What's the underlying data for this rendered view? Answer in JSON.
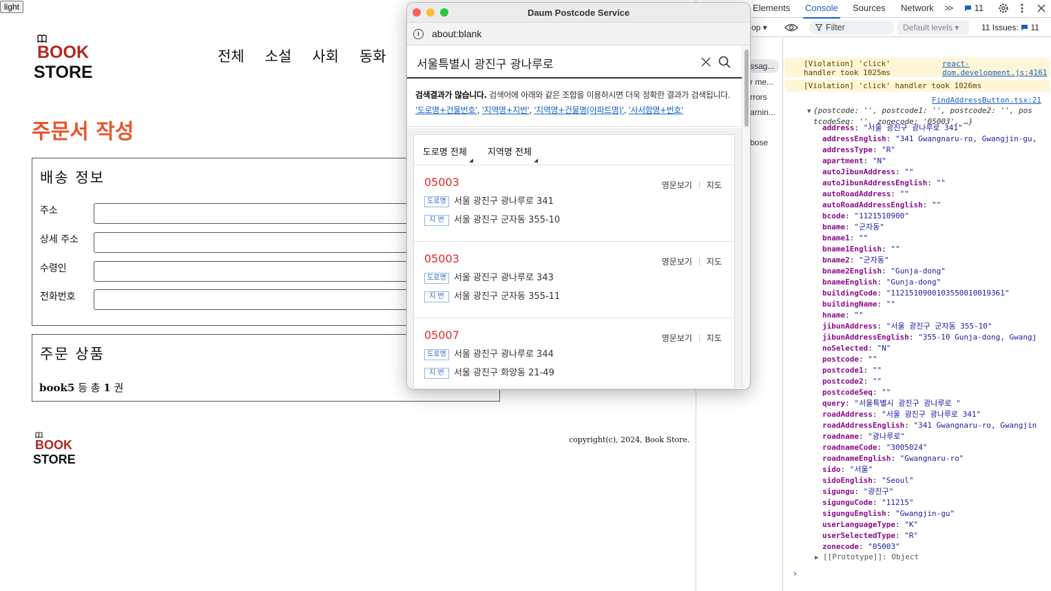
{
  "theme_toggle": "light",
  "logo": {
    "line1": "BOOK",
    "line2": "STORE"
  },
  "nav": [
    "전체",
    "소설",
    "사회",
    "동화"
  ],
  "page_title": "주문서 작성",
  "delivery": {
    "title": "배송 정보",
    "fields": [
      {
        "label": "주소",
        "value": ""
      },
      {
        "label": "상세 주소",
        "value": ""
      },
      {
        "label": "수령인",
        "value": ""
      },
      {
        "label": "전화번호",
        "value": ""
      }
    ]
  },
  "order": {
    "title": "주문 상품",
    "first_book": "book5",
    "mid": " 등 총 ",
    "count": "1",
    "unit": " 권"
  },
  "footer": {
    "logo_line1": "BOOK",
    "logo_line2": "STORE",
    "copyright": "copyright(c), 2024, Book Store."
  },
  "popup": {
    "window_title": "Daum Postcode Service",
    "url": "about:blank",
    "query": "서울특별시 광진구 광나루로",
    "notice_bold": "검색결과가 많습니다.",
    "notice_text": " 검색어에 아래와 같은 조합을 이용하시면 더욱 정확한 결과가 검색됩니다.",
    "hints": [
      "'도로명+건물번호'",
      "'지역명+지번'",
      "'지역명+건물명(아파트명)'",
      "'사서함명+번호'"
    ],
    "filters": [
      "도로명 전체",
      "지역명 전체"
    ],
    "links": {
      "english": "영문보기",
      "map": "지도"
    },
    "tags": {
      "road": "도로명",
      "jibun": "지 번"
    },
    "results": [
      {
        "zip": "05003",
        "road": "서울 광진구 광나루로 341",
        "jibun": "서울 광진구 군자동 355-10"
      },
      {
        "zip": "05003",
        "road": "서울 광진구 광나루로 343",
        "jibun": "서울 광진구 군자동 355-11"
      },
      {
        "zip": "05007",
        "road": "서울 광진구 광나루로 344",
        "jibun": "서울 광진구 화양동 21-49"
      }
    ]
  },
  "devtools": {
    "tabs": [
      "Elements",
      "Console",
      "Sources",
      "Network"
    ],
    "more": ">>",
    "msg_count": "11",
    "context": "op",
    "filter_placeholder": "Filter",
    "levels": "Default levels",
    "issues_label": "11 Issues:",
    "issues_count": "11",
    "sidebar": [
      "ssag...",
      "r me...",
      "rrors",
      "arnin...",
      "bose"
    ],
    "warnings": [
      {
        "text": "[Violation] 'click' handler took 1025ms",
        "link": "react-dom.development.js:4161"
      },
      {
        "text": "[Violation] 'click' handler took 1026ms",
        "link": ""
      }
    ],
    "source_link": "FindAddressButton.tsx:21",
    "object_summary_a": "{postcode: '', postcode1: '', postcode2: '', pos",
    "object_summary_b": "tcodeSeq: '', zonecode: '05003', …}",
    "properties": [
      {
        "k": "address",
        "v": "\"서울 광진구 광나루로 341\""
      },
      {
        "k": "addressEnglish",
        "v": "\"341 Gwangnaru-ro, Gwangjin-gu,"
      },
      {
        "k": "addressType",
        "v": "\"R\""
      },
      {
        "k": "apartment",
        "v": "\"N\""
      },
      {
        "k": "autoJibunAddress",
        "v": "\"\""
      },
      {
        "k": "autoJibunAddressEnglish",
        "v": "\"\""
      },
      {
        "k": "autoRoadAddress",
        "v": "\"\""
      },
      {
        "k": "autoRoadAddressEnglish",
        "v": "\"\""
      },
      {
        "k": "bcode",
        "v": "\"1121510900\""
      },
      {
        "k": "bname",
        "v": "\"군자동\""
      },
      {
        "k": "bname1",
        "v": "\"\""
      },
      {
        "k": "bname1English",
        "v": "\"\""
      },
      {
        "k": "bname2",
        "v": "\"군자동\""
      },
      {
        "k": "bname2English",
        "v": "\"Gunja-dong\""
      },
      {
        "k": "bnameEnglish",
        "v": "\"Gunja-dong\""
      },
      {
        "k": "buildingCode",
        "v": "\"1121510900103550010019361\""
      },
      {
        "k": "buildingName",
        "v": "\"\""
      },
      {
        "k": "hname",
        "v": "\"\""
      },
      {
        "k": "jibunAddress",
        "v": "\"서울 광진구 군자동 355-10\""
      },
      {
        "k": "jibunAddressEnglish",
        "v": "\"355-10 Gunja-dong, Gwangj"
      },
      {
        "k": "noSelected",
        "v": "\"N\""
      },
      {
        "k": "postcode",
        "v": "\"\""
      },
      {
        "k": "postcode1",
        "v": "\"\""
      },
      {
        "k": "postcode2",
        "v": "\"\""
      },
      {
        "k": "postcodeSeq",
        "v": "\"\""
      },
      {
        "k": "query",
        "v": "\"서울특별시 광진구 광나루로 \""
      },
      {
        "k": "roadAddress",
        "v": "\"서울 광진구 광나루로 341\""
      },
      {
        "k": "roadAddressEnglish",
        "v": "\"341 Gwangnaru-ro, Gwangjin"
      },
      {
        "k": "roadname",
        "v": "\"광나루로\""
      },
      {
        "k": "roadnameCode",
        "v": "\"3005024\""
      },
      {
        "k": "roadnameEnglish",
        "v": "\"Gwangnaru-ro\""
      },
      {
        "k": "sido",
        "v": "\"서울\""
      },
      {
        "k": "sidoEnglish",
        "v": "\"Seoul\""
      },
      {
        "k": "sigungu",
        "v": "\"광진구\""
      },
      {
        "k": "sigunguCode",
        "v": "\"11215\""
      },
      {
        "k": "sigunguEnglish",
        "v": "\"Gwangjin-gu\""
      },
      {
        "k": "userLanguageType",
        "v": "\"K\""
      },
      {
        "k": "userSelectedType",
        "v": "\"R\""
      },
      {
        "k": "zonecode",
        "v": "\"05003\""
      }
    ],
    "prototype": "[[Prototype]]: Object"
  }
}
